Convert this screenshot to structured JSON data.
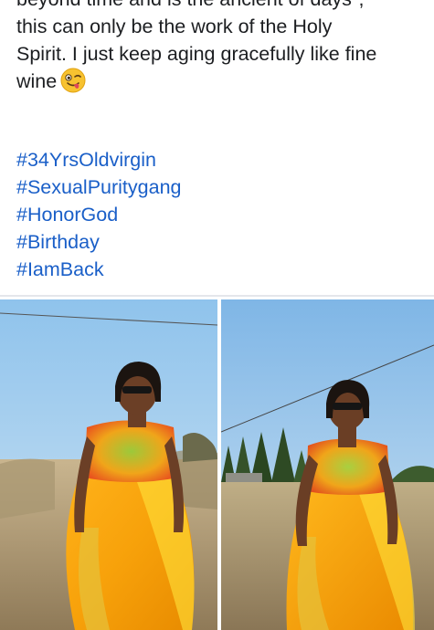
{
  "post": {
    "text_lines": [
      "beyond time and is the ancient of days\",",
      "this can only be the work of the Holy",
      "Spirit. I just keep aging gracefully like fine",
      "wine"
    ],
    "emoji": "winking-face-with-tongue-emoji",
    "hashtags": [
      "#34YrsOldvirgin",
      "#SexualPuritygang",
      "#HonorGod",
      "#Birthday",
      "#IamBack"
    ]
  },
  "photos": [
    {
      "icon": "photo-woman-yellow-dress-field"
    },
    {
      "icon": "photo-woman-yellow-dress-trees"
    }
  ],
  "colors": {
    "text": "#1c1e21",
    "link": "#1a5fc8",
    "divider": "#e4e6eb"
  }
}
